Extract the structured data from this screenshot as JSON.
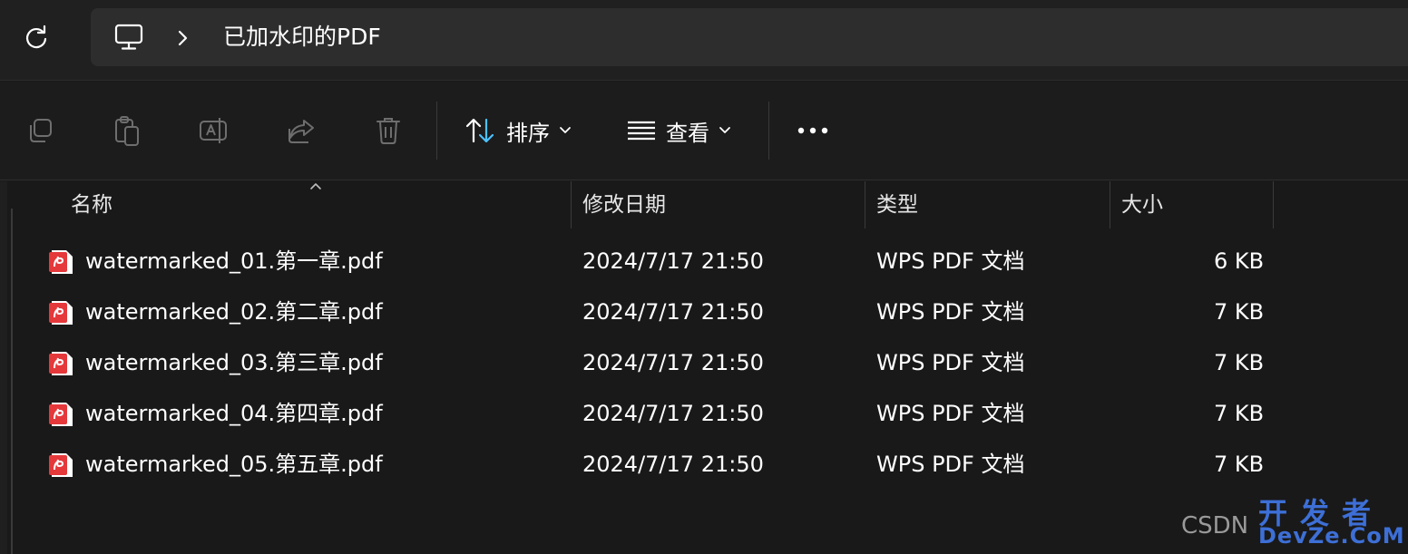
{
  "address_bar": {
    "location_icon": "this-pc-icon",
    "breadcrumb_current": "已加水印的PDF"
  },
  "toolbar": {
    "sort_label": "排序",
    "view_label": "查看"
  },
  "columns": {
    "name": "名称",
    "modified": "修改日期",
    "type": "类型",
    "size": "大小"
  },
  "files": [
    {
      "name": "watermarked_01.第一章.pdf",
      "modified": "2024/7/17 21:50",
      "type": "WPS PDF 文档",
      "size": "6 KB"
    },
    {
      "name": "watermarked_02.第二章.pdf",
      "modified": "2024/7/17 21:50",
      "type": "WPS PDF 文档",
      "size": "7 KB"
    },
    {
      "name": "watermarked_03.第三章.pdf",
      "modified": "2024/7/17 21:50",
      "type": "WPS PDF 文档",
      "size": "7 KB"
    },
    {
      "name": "watermarked_04.第四章.pdf",
      "modified": "2024/7/17 21:50",
      "type": "WPS PDF 文档",
      "size": "7 KB"
    },
    {
      "name": "watermarked_05.第五章.pdf",
      "modified": "2024/7/17 21:50",
      "type": "WPS PDF 文档",
      "size": "7 KB"
    }
  ],
  "watermark": {
    "csdn": "CSDN",
    "site_cn": "开发者",
    "site_en": "DevZe.CoM"
  },
  "colors": {
    "background": "#191919",
    "pdf_icon_red": "#e5383b",
    "watermark_blue": "#3d6fd6"
  }
}
